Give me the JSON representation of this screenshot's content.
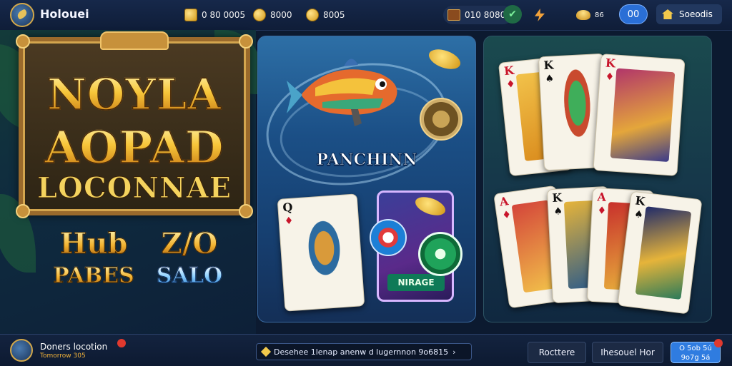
{
  "app": {
    "title": "Holouei"
  },
  "topbar": {
    "stats": [
      {
        "icon": "gold-bar-icon",
        "value": "0 80 0005"
      },
      {
        "icon": "coin-icon",
        "value": "8000"
      },
      {
        "icon": "coin-stack-icon",
        "value": "8005"
      }
    ],
    "chest_value": "010 8080",
    "chat_label": "00",
    "home_label": "Soeodis"
  },
  "left_promo": {
    "line1": "NOYLA",
    "line2": "AOPAD",
    "line3": "LOCONNAE",
    "badge_a_top": "Hub",
    "badge_a_bottom": "PABES",
    "badge_b_top": "Z/O",
    "badge_b_bottom": "SALO"
  },
  "center_panel": {
    "title": "PANCHINN",
    "card": {
      "rank": "Q",
      "suit": "♦"
    },
    "slot_label": "NIRAGE"
  },
  "right_panel": {
    "top_cards": [
      {
        "rank": "K",
        "suit": "♦"
      },
      {
        "rank": "K",
        "suit": "♠"
      },
      {
        "rank": "K",
        "suit": "♦"
      }
    ],
    "bottom_cards": [
      {
        "rank": "A",
        "suit": "♦"
      },
      {
        "rank": "K",
        "suit": "♠"
      },
      {
        "rank": "A",
        "suit": "♦"
      },
      {
        "rank": "K",
        "suit": "♠"
      }
    ]
  },
  "bottombar": {
    "user_name": "Doners locotion",
    "user_sub": "Tomorrow 305",
    "ticker_text": "Desehee 1lenap anenw d lugernnon 9o6815",
    "btn_left": "Rocttere",
    "btn_mid": "Ihesouel Hor",
    "btn_blue_line1": "O 5ob 5ú",
    "btn_blue_line2": "9o7g 5á"
  },
  "colors": {
    "topbar": "#16284a",
    "accent_blue": "#2f7ce0",
    "gold": "#f2b230"
  }
}
